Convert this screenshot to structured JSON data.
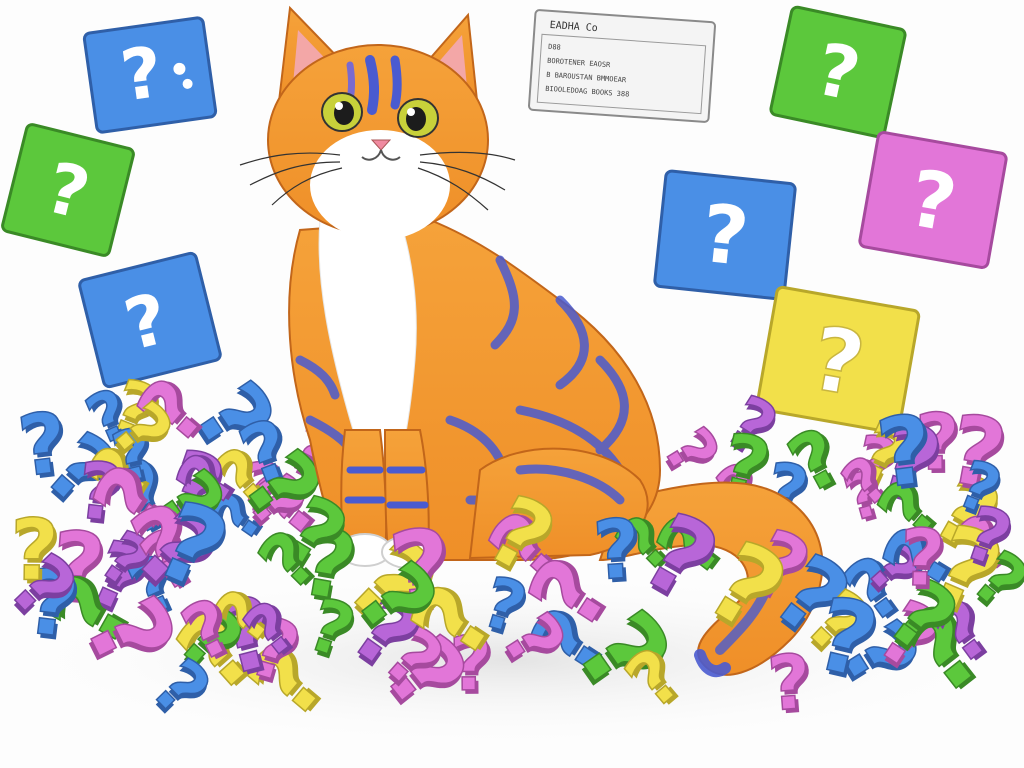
{
  "scene": {
    "background": "#fdfdfd",
    "subject": "cat",
    "colors": {
      "cat_orange": "#f2962f",
      "cat_stripe": "#4a5bd0",
      "cat_white": "#ffffff",
      "eye": "#c8d13a",
      "blue": "#4a8fe6",
      "green": "#5cc83c",
      "pink": "#e276d8",
      "yellow": "#f2e04a",
      "purple": "#b866d8"
    }
  },
  "cards": [
    {
      "id": "card-blue-top-left",
      "glyph": "?",
      "color": "#4a8fe6"
    },
    {
      "id": "card-green-left",
      "glyph": "?",
      "color": "#5cc83c"
    },
    {
      "id": "card-blue-left",
      "glyph": "?",
      "color": "#4a8fe6"
    },
    {
      "id": "card-green-top-right",
      "glyph": "?",
      "color": "#5cc83c"
    },
    {
      "id": "card-blue-mid-right",
      "glyph": "?",
      "color": "#4a8fe6"
    },
    {
      "id": "card-pink-right",
      "glyph": "?",
      "color": "#e276d8"
    },
    {
      "id": "card-yellow-right",
      "glyph": "?",
      "color": "#f2e04a"
    }
  ],
  "document_card": {
    "title": "EADHA Co",
    "lines": [
      "D88",
      "BOROTENER EAOSR",
      "B BAROUSTAN BMMOEAR",
      "BIOOLEDOAG BOOKS 388"
    ]
  },
  "pile": {
    "glyph": "?"
  }
}
